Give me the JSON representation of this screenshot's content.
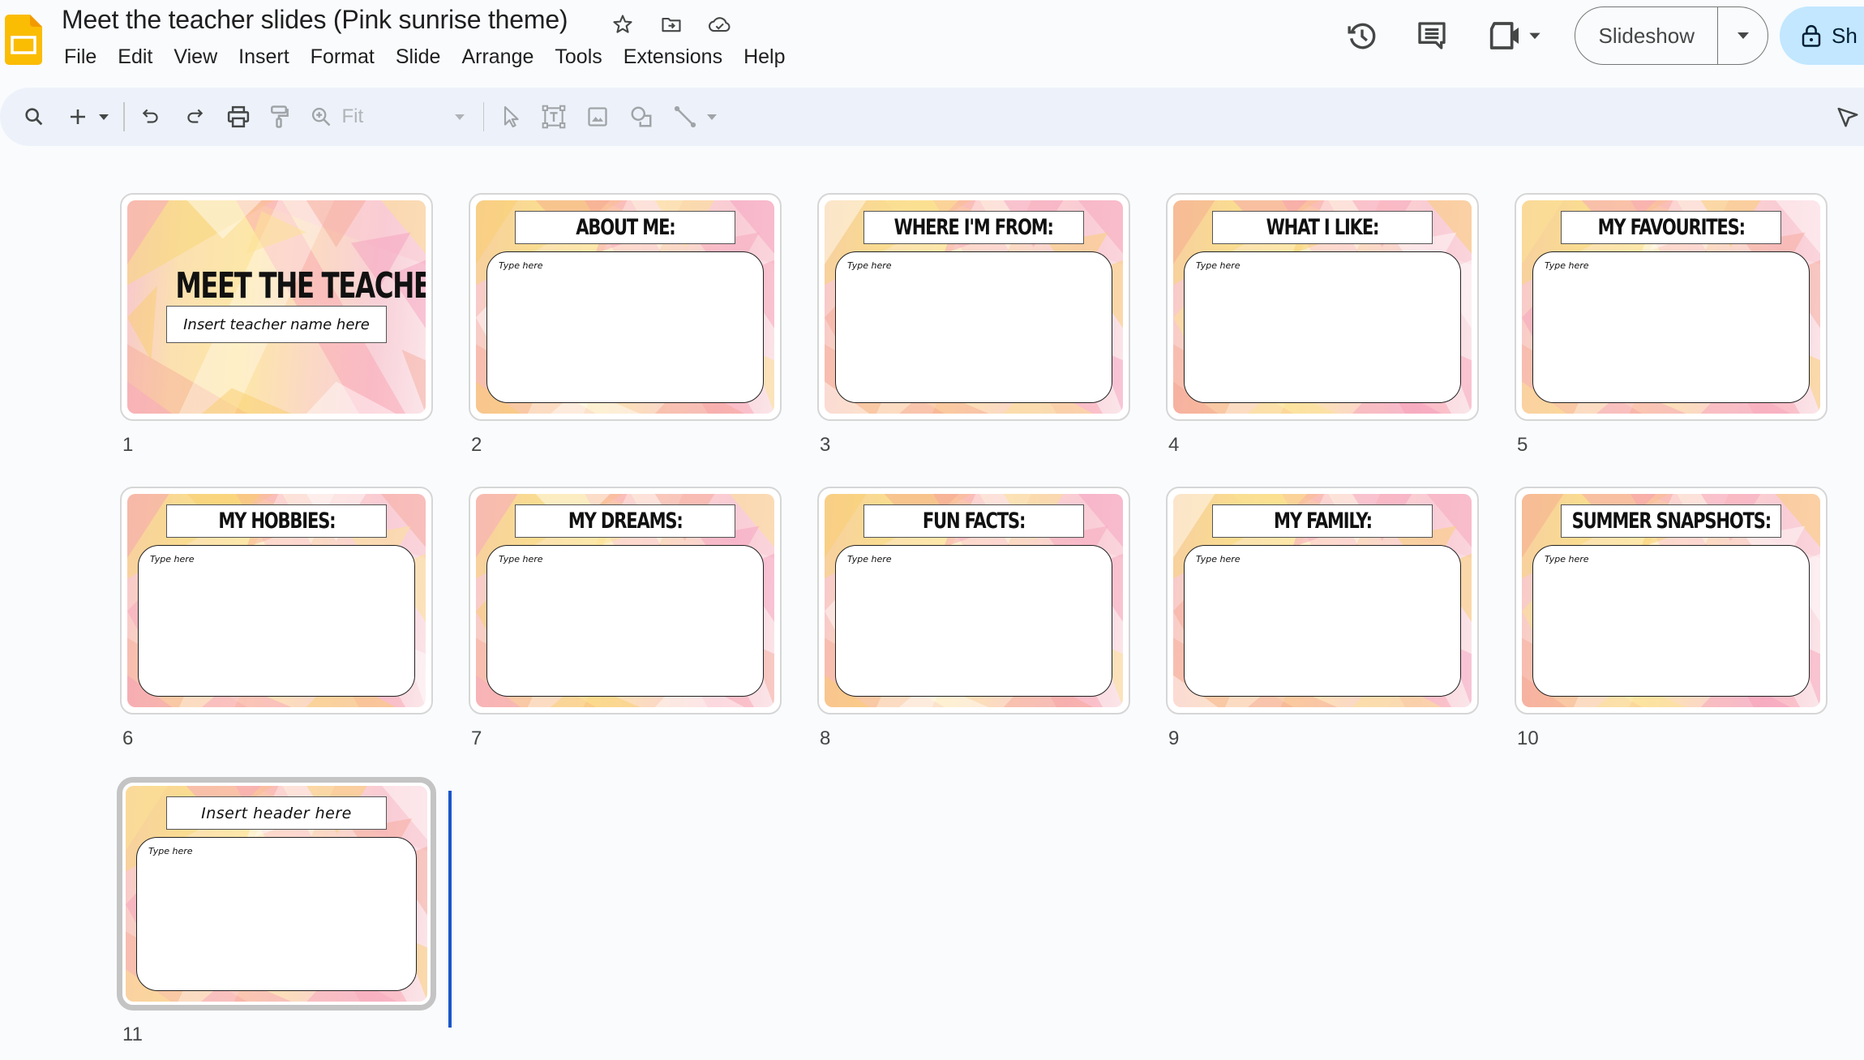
{
  "app": {
    "icon": "google-slides-logo",
    "title": "Meet the teacher slides (Pink sunrise theme)",
    "title_icons": [
      "star-icon",
      "move-to-folder-icon",
      "cloud-saved-icon"
    ]
  },
  "menubar": {
    "items": [
      "File",
      "Edit",
      "View",
      "Insert",
      "Format",
      "Slide",
      "Arrange",
      "Tools",
      "Extensions",
      "Help"
    ]
  },
  "header_right": {
    "icons": [
      "version-history-icon",
      "comments-icon",
      "meet-video-icon"
    ],
    "slideshow_label": "Slideshow",
    "share_label": "Share",
    "share_visible_label": "Sh"
  },
  "toolbar": {
    "tools": [
      "search-menus",
      "new-slide",
      "new-slide-dropdown",
      "undo",
      "redo",
      "print",
      "paint-format",
      "zoom",
      "zoom-select",
      "select",
      "text-box",
      "image",
      "shape",
      "line",
      "line-dropdown"
    ],
    "zoom_value": "Fit",
    "right_tool": "mode-select-cursor"
  },
  "colors": {
    "accent_blue": "#1a56c8",
    "share_bg": "#c2e7ff",
    "toolbar_bg": "#edf2fa",
    "page_bg": "#f9fbfd",
    "logo_yellow": "#fbbc04"
  },
  "slides": [
    {
      "number": "1",
      "type": "title",
      "heading": "MEET THE TEACHER",
      "subtitle": "Insert teacher name here"
    },
    {
      "number": "2",
      "type": "content",
      "header": "ABOUT ME:",
      "body": "Type here"
    },
    {
      "number": "3",
      "type": "content",
      "header": "WHERE I'M FROM:",
      "body": "Type here"
    },
    {
      "number": "4",
      "type": "content",
      "header": "WHAT I LIKE:",
      "body": "Type here"
    },
    {
      "number": "5",
      "type": "content",
      "header": "MY FAVOURITES:",
      "body": "Type here"
    },
    {
      "number": "6",
      "type": "content",
      "header": "MY HOBBIES:",
      "body": "Type here"
    },
    {
      "number": "7",
      "type": "content",
      "header": "MY DREAMS:",
      "body": "Type here"
    },
    {
      "number": "8",
      "type": "content",
      "header": "FUN FACTS:",
      "body": "Type here"
    },
    {
      "number": "9",
      "type": "content",
      "header": "MY FAMILY:",
      "body": "Type here"
    },
    {
      "number": "10",
      "type": "content",
      "header": "SUMMER SNAPSHOTS:",
      "body": "Type here"
    },
    {
      "number": "11",
      "type": "content-cursive",
      "header": "Insert header here",
      "body": "Type here",
      "selected": true
    }
  ]
}
